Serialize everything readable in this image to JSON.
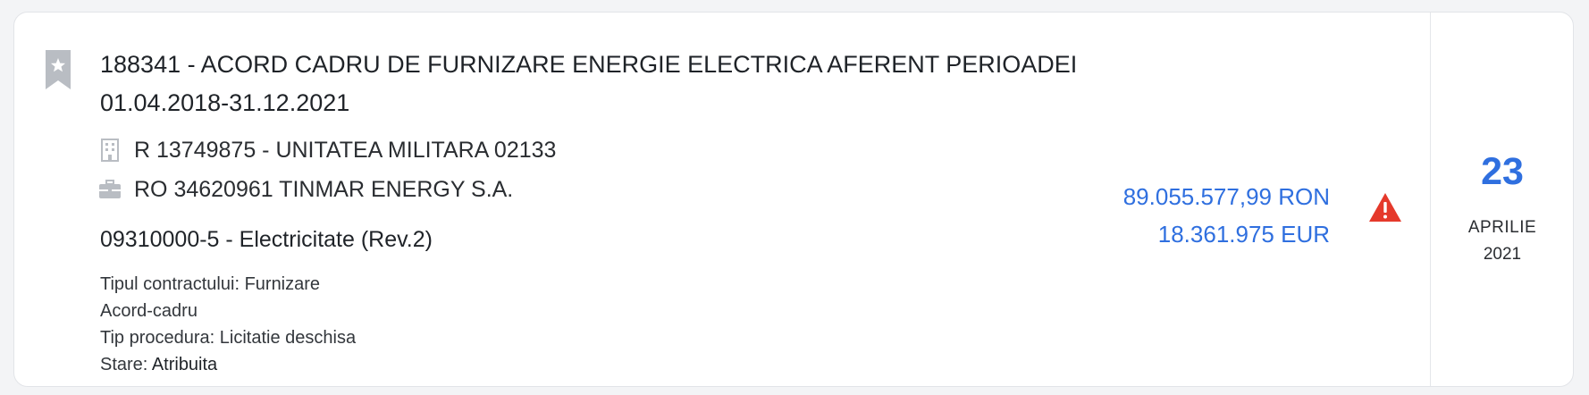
{
  "contract": {
    "title": "188341 - ACORD CADRU DE FURNIZARE ENERGIE ELECTRICA AFERENT PERIOADEI 01.04.2018-31.12.2021",
    "authority": "R 13749875 - UNITATEA MILITARA 02133",
    "supplier": "RO 34620961 TINMAR ENERGY S.A.",
    "cpv": "09310000-5 - Electricitate (Rev.2)",
    "details": {
      "contract_type_label": "Tipul contractului:",
      "contract_type_value": "Furnizare",
      "framework": "Acord-cadru",
      "procedure_label": "Tip procedura:",
      "procedure_value": "Licitatie deschisa",
      "status_label": "Stare:",
      "status_value": "Atribuita"
    },
    "amount_ron": "89.055.577,99 RON",
    "amount_eur": "18.361.975 EUR",
    "date": {
      "day": "23",
      "month": "APRILIE",
      "year": "2021"
    }
  },
  "icons": {
    "bookmark": "bookmark-star-icon",
    "authority": "building-icon",
    "supplier": "briefcase-icon",
    "warning": "warning-triangle-icon"
  },
  "colors": {
    "accent": "#2f6fdf",
    "warning": "#e5392b",
    "icon_gray": "#b9bdc3"
  }
}
